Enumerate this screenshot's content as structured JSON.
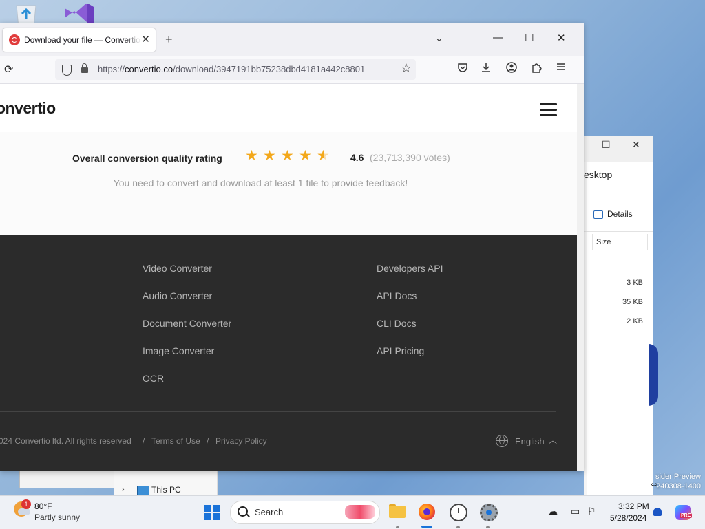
{
  "desktop": {
    "icons": [
      "recycle-bin-icon",
      "visual-studio-icon"
    ],
    "watermark": [
      "sider Preview",
      "240308-1400"
    ]
  },
  "explorer": {
    "address": "esktop",
    "details_label": "Details",
    "size_header": "Size",
    "sizes": [
      "3 KB",
      "35 KB",
      "2 KB"
    ],
    "nav_item": "This PC"
  },
  "browser": {
    "tab_title": "Download your file — Convertio",
    "url_prefix": "https://",
    "url_domain": "convertio.co",
    "url_path": "/download/3947191bb75238dbd4181a442c8801",
    "new_tab": "+",
    "tab_list": "⌄",
    "controls": {
      "minimize": "—",
      "maximize": "☐",
      "close": "✕"
    }
  },
  "page": {
    "logo": "onvertio",
    "rating": {
      "label": "Overall conversion quality rating",
      "value": "4.6",
      "votes": "(23,713,390 votes)",
      "stars": 4.6,
      "star_color": "#f3a81b"
    },
    "feedback": "You need to convert and download at least 1 file to provide feedback!",
    "footer": {
      "col1": [
        "Video Converter",
        "Audio Converter",
        "Document Converter",
        "Image Converter",
        "OCR"
      ],
      "col2": [
        "Developers API",
        "API Docs",
        "CLI Docs",
        "API Pricing"
      ],
      "copyright": "024 Convertio ltd. All rights reserved",
      "sep": "/",
      "terms": "Terms of Use",
      "privacy": "Privacy Policy",
      "language": "English"
    }
  },
  "taskbar": {
    "weather": {
      "badge": "1",
      "temp": "80°F",
      "desc": "Partly sunny"
    },
    "search_label": "Search",
    "time": "3:32 PM",
    "date": "5/28/2024",
    "copilot_badge": "PRE"
  }
}
